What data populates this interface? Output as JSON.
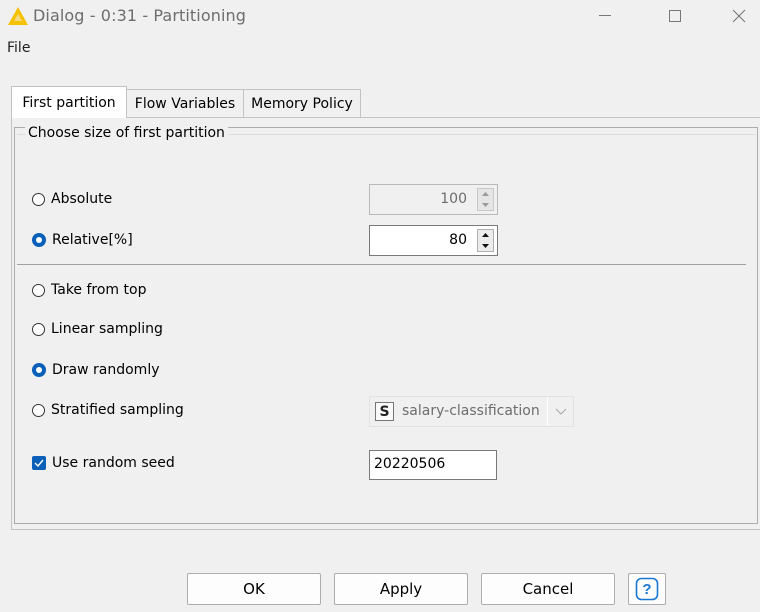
{
  "window": {
    "title": "Dialog - 0:31 - Partitioning"
  },
  "menu": {
    "file": "File"
  },
  "tabs": [
    {
      "label": "First partition",
      "active": true
    },
    {
      "label": "Flow Variables",
      "active": false
    },
    {
      "label": "Memory Policy",
      "active": false
    }
  ],
  "group": {
    "label": "Choose size of first partition"
  },
  "size_mode": {
    "absolute": {
      "label": "Absolute",
      "selected": false,
      "value": "100",
      "enabled": false
    },
    "relative": {
      "label": "Relative[%]",
      "selected": true,
      "value": "80",
      "enabled": true
    }
  },
  "sampling": [
    {
      "label": "Take from top",
      "selected": false
    },
    {
      "label": "Linear sampling",
      "selected": false
    },
    {
      "label": "Draw randomly",
      "selected": true
    },
    {
      "label": "Stratified sampling",
      "selected": false
    }
  ],
  "stratified_column": {
    "type_badge": "S",
    "value": "salary-classification",
    "enabled": false
  },
  "random_seed": {
    "label": "Use random seed",
    "checked": true,
    "value": "20220506"
  },
  "buttons": {
    "ok": "OK",
    "apply": "Apply",
    "cancel": "Cancel",
    "help": "?"
  },
  "colors": {
    "accent": "#0a5fb9",
    "app_icon": "#f6c100"
  }
}
